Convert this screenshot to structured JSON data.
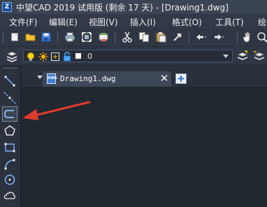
{
  "window": {
    "title": "中望CAD 2019 试用版 (剩余 17 天) - [Drawing1.dwg]"
  },
  "menubar": {
    "items": [
      "文件(F)",
      "编辑(E)",
      "视图(V)",
      "插入(I)",
      "格式(O)",
      "工具(T)",
      "绘"
    ]
  },
  "toolbar": {
    "icons": [
      "new-file-icon",
      "open-folder-icon",
      "save-icon",
      "print-icon",
      "print-preview-icon",
      "publish-icon",
      "cut-icon",
      "copy-icon",
      "paste-icon",
      "match-properties-icon",
      "undo-icon",
      "redo-icon",
      "pan-hand-icon",
      "zoom-icon"
    ]
  },
  "layer_toolbar": {
    "current_layer": "0",
    "icons": [
      "layer-manager-icon",
      "bulb-on-icon",
      "sun-freeze-icon",
      "lock-icon",
      "layer-color-swatch"
    ]
  },
  "draw_toolbar": {
    "tools": [
      "line-icon",
      "construction-line-icon",
      "polyline-icon",
      "polygon-icon",
      "rectangle-icon",
      "arc-icon",
      "circle-icon",
      "revision-cloud-icon"
    ],
    "active_tool": "polyline-icon"
  },
  "document_tabs": {
    "tabs": [
      {
        "label": "Drawing1.dwg",
        "icon": "dwg-file-icon",
        "active": true
      }
    ]
  },
  "annotation": {
    "arrow_color": "#e03a2e"
  },
  "colors": {
    "background": "#212830",
    "titlebar": "#3b4453",
    "accent": "#3f7fd6"
  }
}
